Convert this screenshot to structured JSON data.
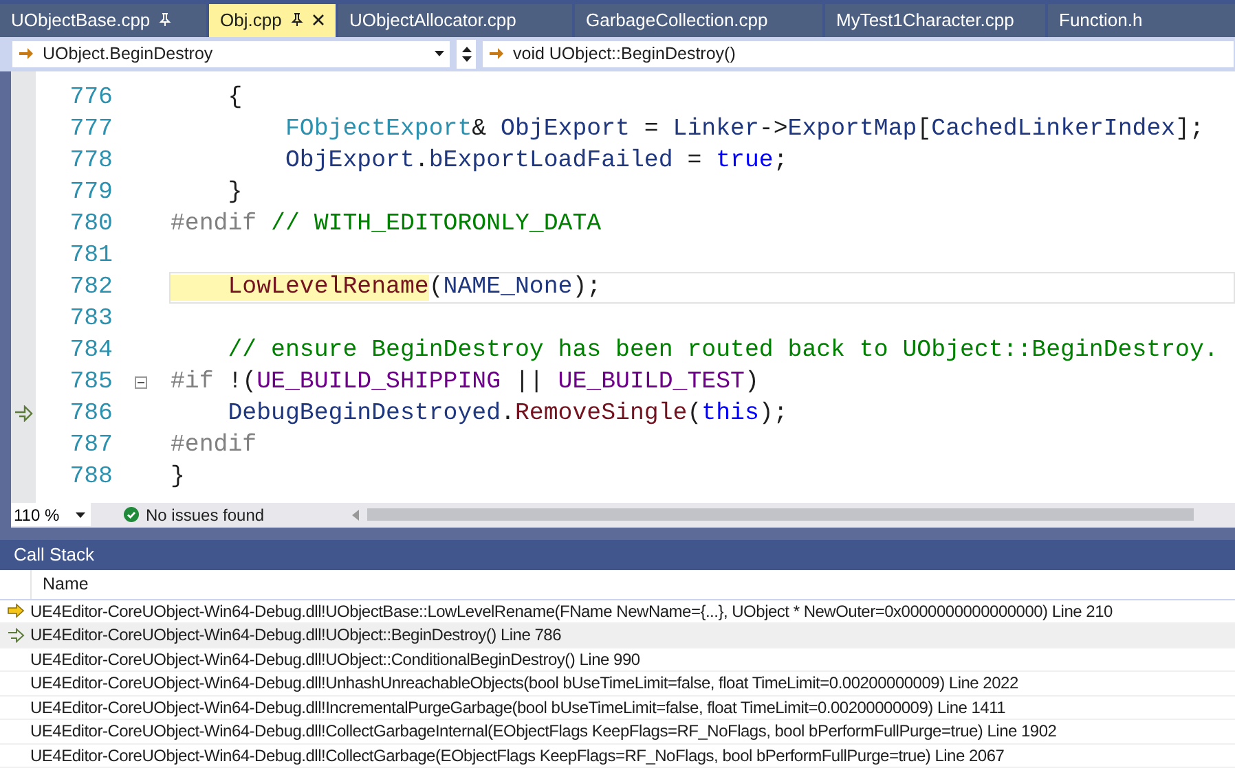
{
  "tabs": [
    {
      "label": "UObjectBase.cpp",
      "selected": false,
      "pinned": true
    },
    {
      "label": "Obj.cpp",
      "selected": true,
      "pinned": true
    },
    {
      "label": "UObjectAllocator.cpp",
      "selected": false,
      "pinned": false
    },
    {
      "label": "GarbageCollection.cpp",
      "selected": false,
      "pinned": false
    },
    {
      "label": "MyTest1Character.cpp",
      "selected": false,
      "pinned": false
    },
    {
      "label": "Function.h",
      "selected": false,
      "pinned": false
    }
  ],
  "navigation": {
    "scope": "UObject.BeginDestroy",
    "member": "void UObject::BeginDestroy()"
  },
  "code_lines": [
    {
      "number": "776",
      "current": false,
      "return_point": false,
      "foldable": false,
      "tokens": [
        {
          "text": "    {",
          "kind": "plain"
        }
      ]
    },
    {
      "number": "777",
      "current": false,
      "return_point": false,
      "foldable": false,
      "tokens": [
        {
          "text": "        FObjectExport",
          "kind": "type"
        },
        {
          "text": "& ",
          "kind": "plain"
        },
        {
          "text": "ObjExport",
          "kind": "variable"
        },
        {
          "text": " = ",
          "kind": "plain"
        },
        {
          "text": "Linker",
          "kind": "variable"
        },
        {
          "text": "->",
          "kind": "plain"
        },
        {
          "text": "ExportMap",
          "kind": "variable"
        },
        {
          "text": "[",
          "kind": "plain"
        },
        {
          "text": "CachedLinkerIndex",
          "kind": "variable"
        },
        {
          "text": "];",
          "kind": "plain"
        }
      ]
    },
    {
      "number": "778",
      "current": false,
      "return_point": false,
      "foldable": false,
      "tokens": [
        {
          "text": "        ObjExport",
          "kind": "variable"
        },
        {
          "text": ".",
          "kind": "plain"
        },
        {
          "text": "bExportLoadFailed",
          "kind": "variable"
        },
        {
          "text": " = ",
          "kind": "plain"
        },
        {
          "text": "true",
          "kind": "keyword"
        },
        {
          "text": ";",
          "kind": "plain"
        }
      ]
    },
    {
      "number": "779",
      "current": false,
      "return_point": false,
      "foldable": false,
      "tokens": [
        {
          "text": "    }",
          "kind": "plain"
        }
      ]
    },
    {
      "number": "780",
      "current": false,
      "return_point": false,
      "foldable": false,
      "tokens": [
        {
          "text": "#endif",
          "kind": "preprocessor"
        },
        {
          "text": " // WITH_EDITORONLY_DATA",
          "kind": "comment"
        }
      ]
    },
    {
      "number": "781",
      "current": false,
      "return_point": false,
      "foldable": false
    },
    {
      "number": "782",
      "current": true,
      "return_point": false,
      "foldable": false,
      "tokens": [
        {
          "text": "    LowLevelRename",
          "kind": "reference"
        },
        {
          "text": "(",
          "kind": "plain"
        },
        {
          "text": "NAME_None",
          "kind": "variable"
        },
        {
          "text": ");",
          "kind": "plain"
        }
      ]
    },
    {
      "number": "783",
      "current": false,
      "return_point": false,
      "foldable": false
    },
    {
      "number": "784",
      "current": false,
      "return_point": false,
      "foldable": false,
      "tokens": [
        {
          "text": "    // ensure BeginDestroy has been routed back to UObject::BeginDestroy.",
          "kind": "comment"
        }
      ]
    },
    {
      "number": "785",
      "current": false,
      "return_point": false,
      "foldable": true,
      "tokens": [
        {
          "text": "#if",
          "kind": "preprocessor"
        },
        {
          "text": " !(",
          "kind": "plain"
        },
        {
          "text": "UE_BUILD_SHIPPING",
          "kind": "macro"
        },
        {
          "text": " || ",
          "kind": "plain"
        },
        {
          "text": "UE_BUILD_TEST",
          "kind": "macro"
        },
        {
          "text": ")",
          "kind": "plain"
        }
      ]
    },
    {
      "number": "786",
      "current": false,
      "return_point": true,
      "foldable": false,
      "tokens": [
        {
          "text": "    DebugBeginDestroyed",
          "kind": "variable"
        },
        {
          "text": ".",
          "kind": "plain"
        },
        {
          "text": "RemoveSingle",
          "kind": "function"
        },
        {
          "text": "(",
          "kind": "plain"
        },
        {
          "text": "this",
          "kind": "keyword"
        },
        {
          "text": ");",
          "kind": "plain"
        }
      ]
    },
    {
      "number": "787",
      "current": false,
      "return_point": false,
      "foldable": false,
      "tokens": [
        {
          "text": "#endif",
          "kind": "preprocessor"
        }
      ]
    },
    {
      "number": "788",
      "current": false,
      "return_point": false,
      "foldable": false,
      "tokens": [
        {
          "text": "}",
          "kind": "plain"
        }
      ]
    }
  ],
  "status_bar": {
    "zoom": "110 %",
    "issues": "No issues found"
  },
  "call_stack": {
    "title": "Call Stack",
    "columns": [
      "Name"
    ],
    "rows": [
      {
        "kind": "current",
        "selected": false,
        "name": "UE4Editor-CoreUObject-Win64-Debug.dll!UObjectBase::LowLevelRename(FName NewName={...}, UObject * NewOuter=0x0000000000000000) Line 210"
      },
      {
        "kind": "return",
        "selected": true,
        "name": "UE4Editor-CoreUObject-Win64-Debug.dll!UObject::BeginDestroy() Line 786"
      },
      {
        "kind": "frame",
        "selected": false,
        "name": "UE4Editor-CoreUObject-Win64-Debug.dll!UObject::ConditionalBeginDestroy() Line 990"
      },
      {
        "kind": "frame",
        "selected": false,
        "name": "UE4Editor-CoreUObject-Win64-Debug.dll!UnhashUnreachableObjects(bool bUseTimeLimit=false, float TimeLimit=0.00200000009) Line 2022"
      },
      {
        "kind": "frame",
        "selected": false,
        "name": "UE4Editor-CoreUObject-Win64-Debug.dll!IncrementalPurgeGarbage(bool bUseTimeLimit=false, float TimeLimit=0.00200000009) Line 1411"
      },
      {
        "kind": "frame",
        "selected": false,
        "name": "UE4Editor-CoreUObject-Win64-Debug.dll!CollectGarbageInternal(EObjectFlags KeepFlags=RF_NoFlags, bool bPerformFullPurge=true) Line 1902"
      },
      {
        "kind": "frame",
        "selected": false,
        "name": "UE4Editor-CoreUObject-Win64-Debug.dll!CollectGarbage(EObjectFlags KeepFlags=RF_NoFlags, bool bPerformFullPurge=true) Line 2067"
      }
    ]
  }
}
